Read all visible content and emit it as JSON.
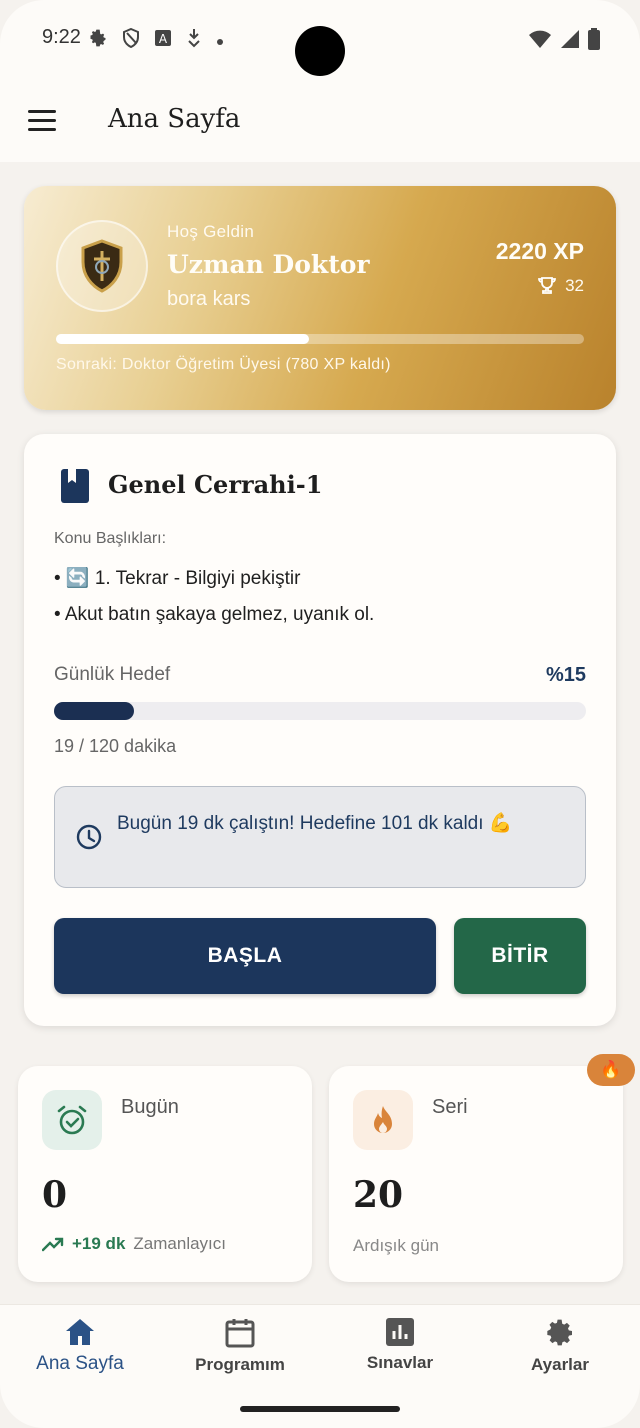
{
  "status_bar": {
    "time": "9:22"
  },
  "app_bar": {
    "title": "Ana Sayfa"
  },
  "profile": {
    "welcome": "Hoş Geldin",
    "rank": "Uzman Doktor",
    "username": "bora kars",
    "xp": "2220 XP",
    "trophies": "32",
    "xp_progress_percent": 48,
    "next_rank": "Sonraki: Doktor Öğretim Üyesi (780 XP kaldı)"
  },
  "course": {
    "title": "Genel Cerrahi-1",
    "topics_label": "Konu Başlıkları:",
    "topics": [
      "• 🔄 1. Tekrar - Bilgiyi pekiştir",
      "• Akut batın şakaya gelmez, uyanık ol."
    ],
    "goal_label": "Günlük Hedef",
    "goal_percent_text": "%15",
    "goal_percent": 15,
    "goal_minutes": "19 / 120 dakika",
    "info_message": "Bugün 19 dk çalıştın! Hedefine 101 dk kaldı 💪",
    "start_label": "BAŞLA",
    "finish_label": "BİTİR"
  },
  "stats": {
    "today": {
      "label": "Bugün",
      "value": "0",
      "trend": "+19 dk",
      "trend_desc": "Zamanlayıcı"
    },
    "streak": {
      "label": "Seri",
      "value": "20",
      "sub": "Ardışık gün",
      "badge": "🔥"
    }
  },
  "nav": {
    "items": [
      {
        "label": "Ana Sayfa",
        "icon": "home-icon",
        "active": true
      },
      {
        "label": "Programım",
        "icon": "calendar-icon",
        "active": false
      },
      {
        "label": "Sınavlar",
        "icon": "chart-icon",
        "active": false
      },
      {
        "label": "Ayarlar",
        "icon": "gear-icon",
        "active": false
      }
    ]
  },
  "colors": {
    "primary": "#1c365c",
    "success": "#236748",
    "gold": "#d6a94f",
    "accent_orange": "#d9843a"
  }
}
